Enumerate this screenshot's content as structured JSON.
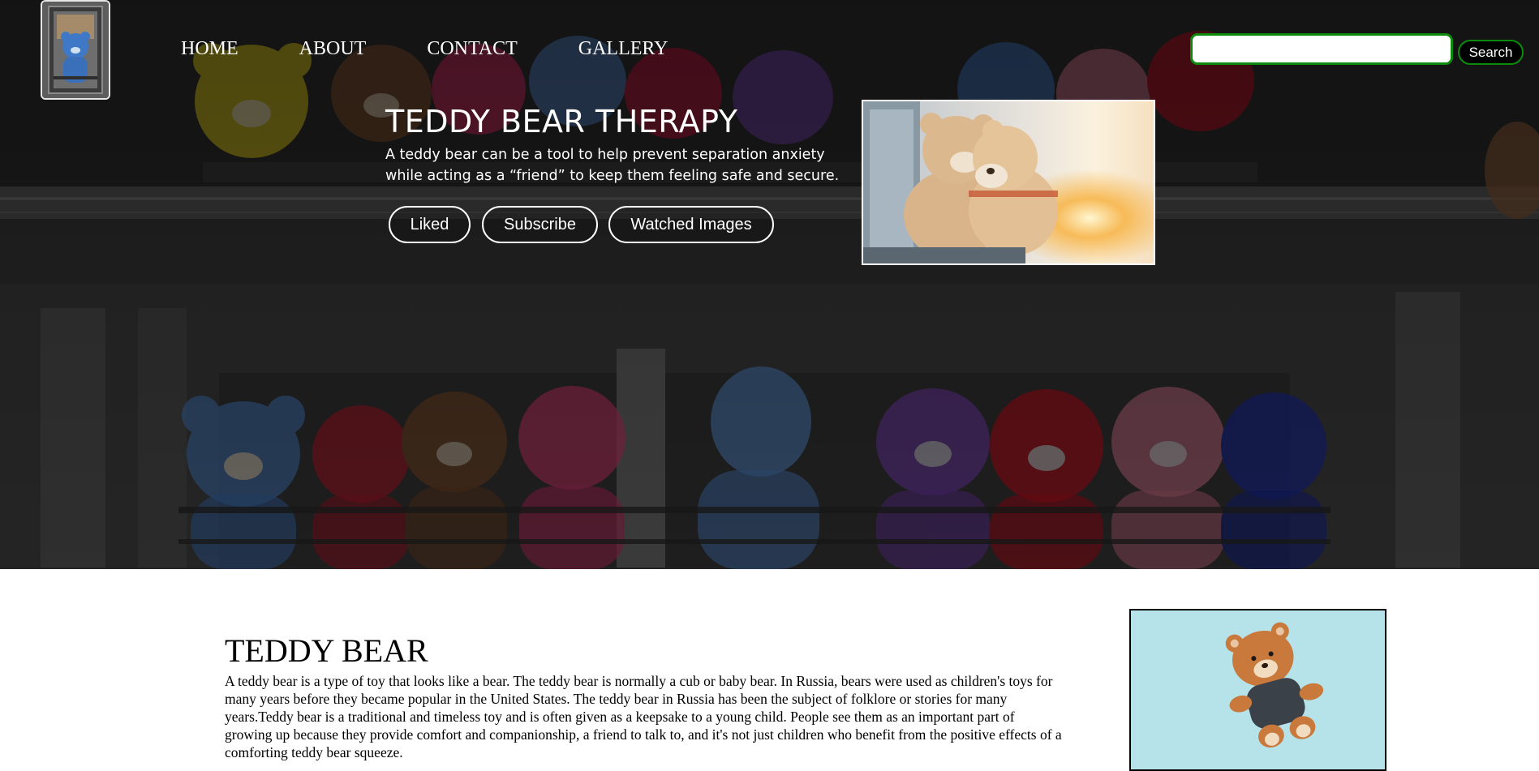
{
  "header": {
    "logo": {
      "alt": "Teddy bear logo",
      "icon": "teddy-bear-logo-icon"
    },
    "nav": [
      {
        "label": "HOME"
      },
      {
        "label": "ABOUT"
      },
      {
        "label": "CONTACT"
      },
      {
        "label": "GALLERY"
      }
    ],
    "search": {
      "value": "",
      "placeholder": "",
      "button_label": "Search"
    }
  },
  "hero": {
    "title": "TEDDY BEAR THERAPY",
    "description": "A teddy bear can be a tool to help prevent separation anxiety while acting as a “friend” to keep them feeling safe and secure.",
    "buttons": [
      {
        "label": "Liked"
      },
      {
        "label": "Subscribe"
      },
      {
        "label": "Watched Images"
      }
    ],
    "photo_alt": "Two teddy bears sitting at sunset"
  },
  "article": {
    "title": "TEDDY BEAR",
    "body": "A teddy bear is a type of toy that looks like a bear. The teddy bear is normally a cub or baby bear. In Russia, bears were used as children's toys for many years before they became popular in the United States. The teddy bear in Russia has been the subject of folklore or stories for many years.Teddy bear is a traditional and timeless toy and is often given as a keepsake to a young child. People see them as an important part of growing up because they provide comfort and companionship, a friend to talk to, and it's not just children who benefit from the positive effects of a comforting teddy bear squeeze.",
    "photo_alt": "Brown teddy bear on light blue background"
  },
  "colors": {
    "search_border": "#0b8a0b",
    "hero_overlay": "#151515",
    "accent_white": "#ffffff"
  }
}
